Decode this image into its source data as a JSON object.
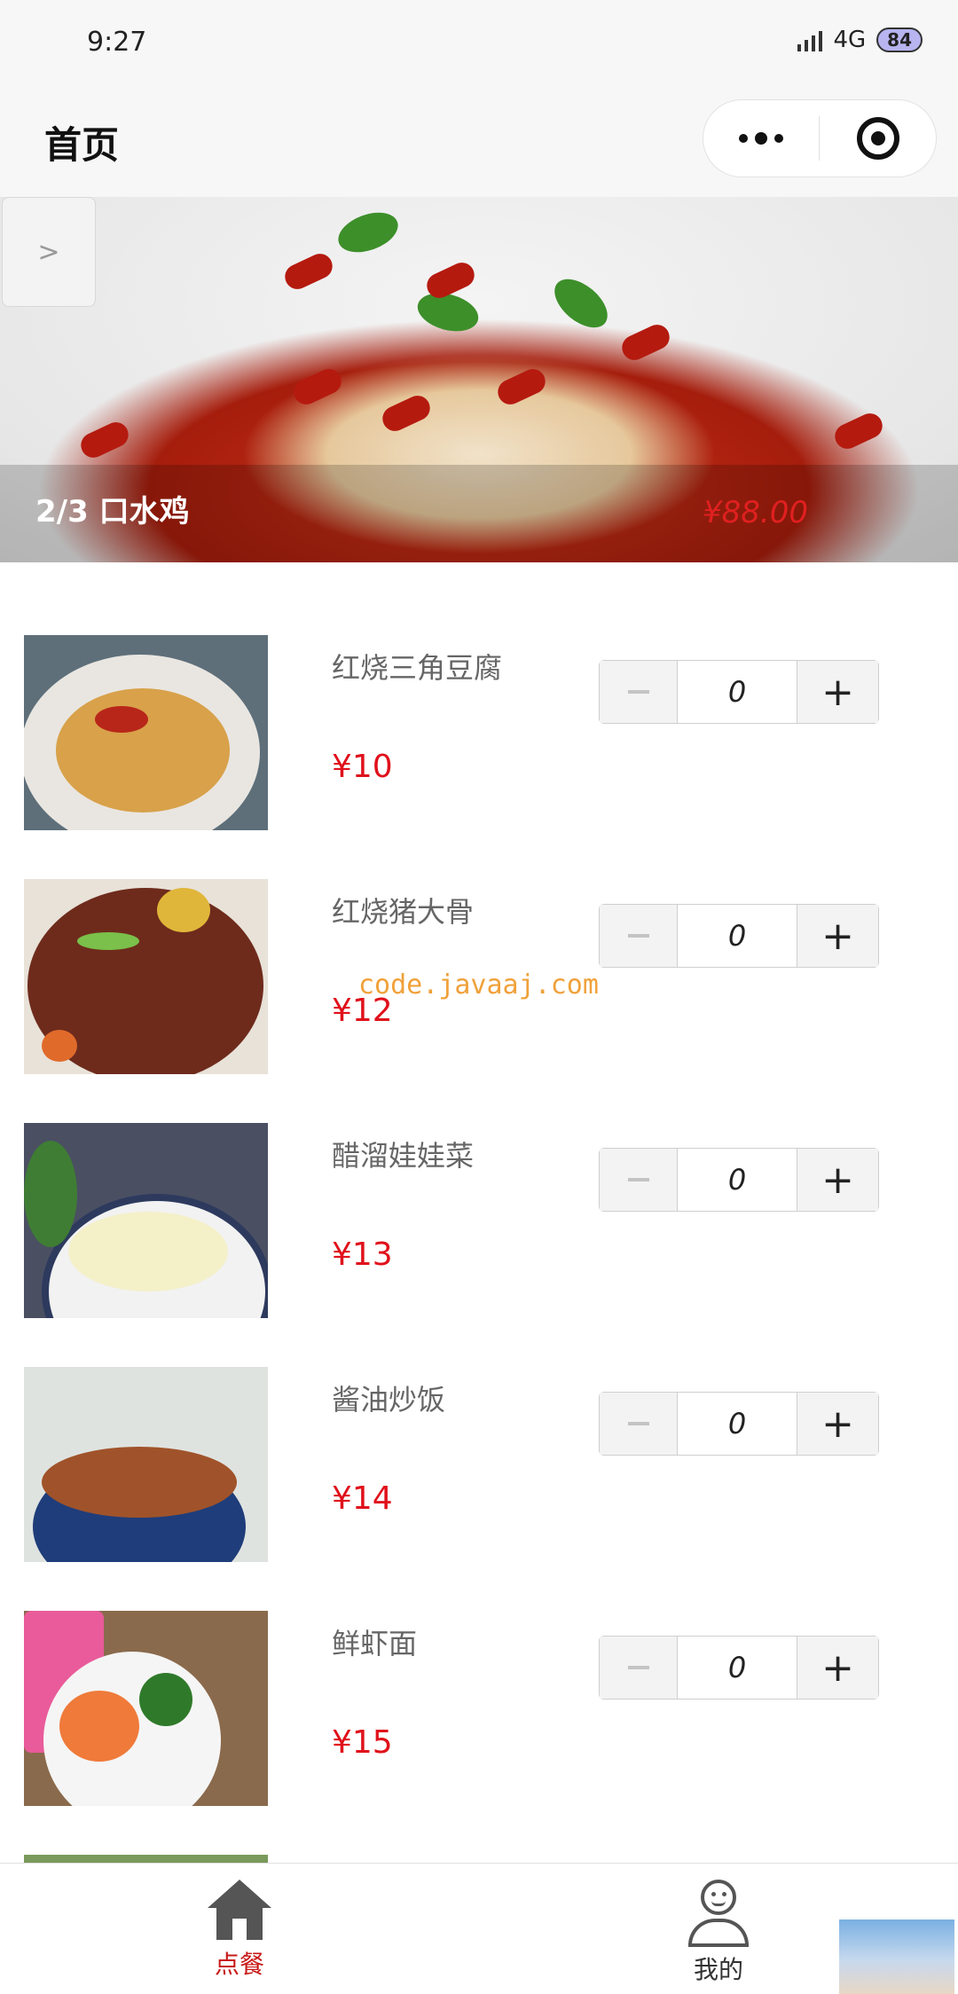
{
  "status_bar": {
    "time": "9:27",
    "network": "4G",
    "battery": "84"
  },
  "nav": {
    "title": "首页",
    "more_icon": "more-dots-icon",
    "close_icon": "target-circle-icon"
  },
  "banner": {
    "caption": "2/3 口水鸡",
    "price": "¥88.00",
    "arrow": ">"
  },
  "menu": [
    {
      "name": "红烧三角豆腐",
      "price": "¥10",
      "count": "0"
    },
    {
      "name": "红烧猪大骨",
      "price": "¥12",
      "count": "0"
    },
    {
      "name": "醋溜娃娃菜",
      "price": "¥13",
      "count": "0"
    },
    {
      "name": "酱油炒饭",
      "price": "¥14",
      "count": "0"
    },
    {
      "name": "鲜虾面",
      "price": "¥15",
      "count": "0"
    }
  ],
  "stepper": {
    "plus": "+"
  },
  "watermark": "code.javaaj.com",
  "tabs": [
    {
      "label": "点餐",
      "icon": "home-icon",
      "active": true
    },
    {
      "label": "我的",
      "icon": "user-icon",
      "active": false
    }
  ],
  "colors": {
    "price": "#e0111b",
    "active_tab": "#c81818",
    "watermark": "#f0a13a"
  }
}
